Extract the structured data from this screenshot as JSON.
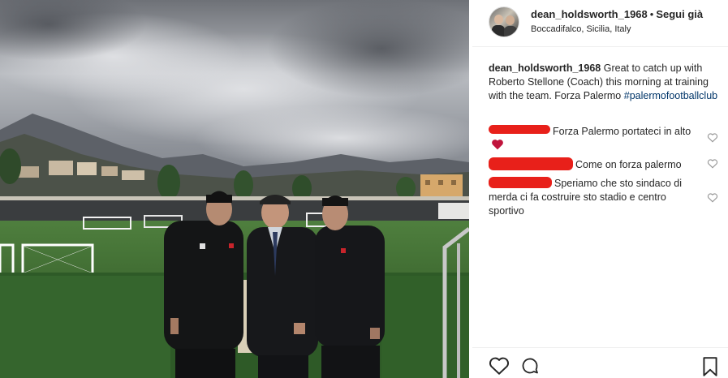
{
  "post": {
    "username": "dean_holdsworth_1968",
    "separator": "•",
    "follow_label": "Segui già",
    "location": "Boccadifalco, Sicilia, Italy"
  },
  "caption": {
    "username": "dean_holdsworth_1968",
    "text": "Great to catch up with Roberto Stellone (Coach) this morning at training with the team. Forza Palermo",
    "hashtag": "#palermofootballclub"
  },
  "comments": [
    {
      "text": "Forza Palermo portateci in alto",
      "has_heart_emoji": true
    },
    {
      "text": "Come on forza palermo",
      "has_heart_emoji": false
    },
    {
      "text": "Speriamo che sto sindaco di merda ci fa costruire sto stadio e centro sportivo",
      "has_heart_emoji": false
    }
  ],
  "icons": {
    "like": "heart-icon",
    "comment": "comment-icon",
    "save": "bookmark-icon",
    "comment_like": "small-heart-icon"
  },
  "colors": {
    "text": "#262626",
    "hashtag": "#003569",
    "redaction": "#e8201a",
    "heart_emoji": "#c0143c"
  }
}
